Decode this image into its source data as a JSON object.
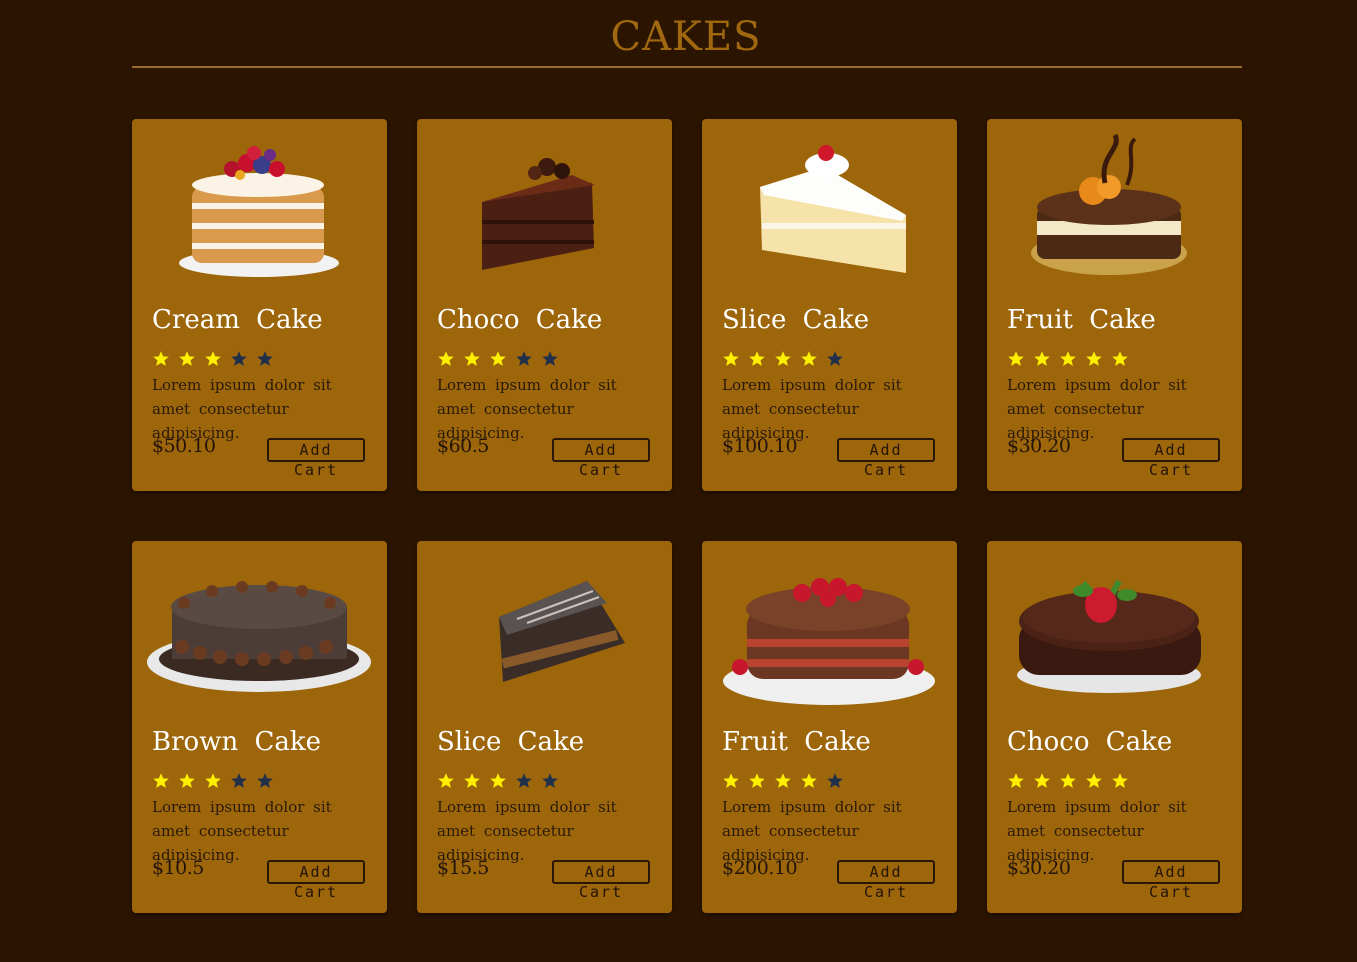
{
  "page": {
    "title": "CAKES"
  },
  "colors": {
    "background": "#2c1500",
    "card": "#9d660b",
    "title": "#a1690f",
    "star_on": "#ffef00",
    "star_off": "#20304a"
  },
  "products": [
    {
      "name": "Cream  Cake",
      "rating": 3,
      "desc": "Lorem ipsum dolor sit amet consectetur adipisicing.",
      "price": "$50.10",
      "button": "Add Cart",
      "image": "naked-layer-cake-with-berries"
    },
    {
      "name": "Choco  Cake",
      "rating": 3,
      "desc": "Lorem ipsum dolor sit amet consectetur adipisicing.",
      "price": "$60.5",
      "button": "Add Cart",
      "image": "chocolate-cake-slice"
    },
    {
      "name": "Slice  Cake",
      "rating": 4,
      "desc": "Lorem ipsum dolor sit amet consectetur adipisicing.",
      "price": "$100.10",
      "button": "Add Cart",
      "image": "vanilla-cream-cake-slice"
    },
    {
      "name": "Fruit  Cake",
      "rating": 5,
      "desc": "Lorem ipsum dolor sit amet consectetur adipisicing.",
      "price": "$30.20",
      "button": "Add Cart",
      "image": "chocolate-mousse-cake-with-fruit"
    },
    {
      "name": "Brown  Cake",
      "rating": 3,
      "desc": "Lorem ipsum dolor sit amet consectetur adipisicing.",
      "price": "$10.5",
      "button": "Add Cart",
      "image": "frosted-brown-cake"
    },
    {
      "name": "Slice  Cake",
      "rating": 3,
      "desc": "Lorem ipsum dolor sit amet consectetur adipisicing.",
      "price": "$15.5",
      "button": "Add Cart",
      "image": "layered-chocolate-slice"
    },
    {
      "name": "Fruit  Cake",
      "rating": 4,
      "desc": "Lorem ipsum dolor sit amet consectetur adipisicing.",
      "price": "$200.10",
      "button": "Add Cart",
      "image": "strawberry-chocolate-cake"
    },
    {
      "name": "Choco  Cake",
      "rating": 5,
      "desc": "Lorem ipsum dolor sit amet consectetur adipisicing.",
      "price": "$30.20",
      "button": "Add Cart",
      "image": "ganache-cake-with-strawberry"
    }
  ]
}
